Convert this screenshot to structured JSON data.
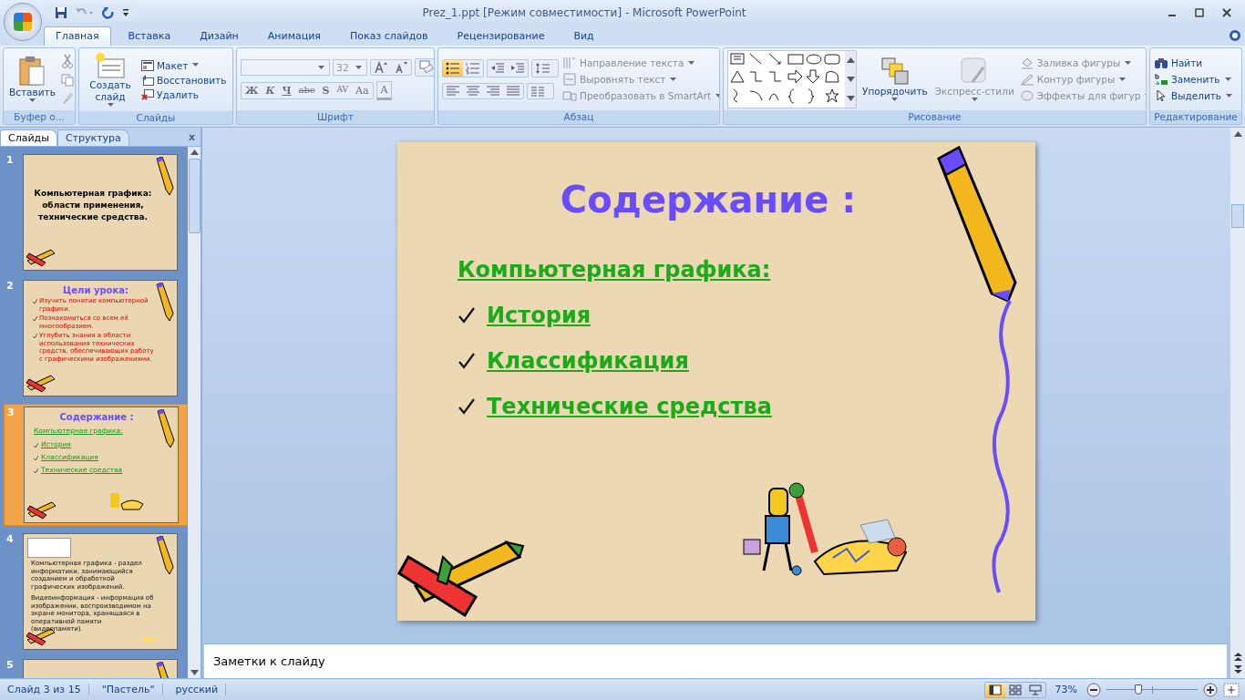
{
  "window": {
    "title": "Prez_1.ppt [Режим совместимости] - Microsoft PowerPoint"
  },
  "tabs": [
    {
      "label": "Главная",
      "selected": true
    },
    {
      "label": "Вставка",
      "selected": false
    },
    {
      "label": "Дизайн",
      "selected": false
    },
    {
      "label": "Анимация",
      "selected": false
    },
    {
      "label": "Показ слайдов",
      "selected": false
    },
    {
      "label": "Рецензирование",
      "selected": false
    },
    {
      "label": "Вид",
      "selected": false
    }
  ],
  "ribbon": {
    "clipboard": {
      "label": "Буфер о...",
      "paste": "Вставить"
    },
    "slides": {
      "label": "Слайды",
      "new_slide": "Создать слайд",
      "layout": "Макет",
      "reset": "Восстановить",
      "delete": "Удалить"
    },
    "font": {
      "label": "Шрифт",
      "disabled": true,
      "size": "32",
      "bold": "Ж",
      "italic": "К",
      "underline": "Ч",
      "strike": "abc",
      "shadow": "S",
      "spacing": "AV",
      "case": "Aa",
      "text_color_glyph": "A"
    },
    "paragraph": {
      "label": "Абзац",
      "bullets_on": true,
      "tools": [
        {
          "label": "Направление текста",
          "disabled": true
        },
        {
          "label": "Выровнять текст",
          "disabled": true
        },
        {
          "label": "Преобразовать в SmartArt",
          "disabled": true
        }
      ]
    },
    "drawing": {
      "label": "Рисование",
      "arrange": "Упорядочить",
      "quick_styles": {
        "label": "Экспресс-стили",
        "disabled": true
      },
      "tools": [
        {
          "label": "Заливка фигуры",
          "disabled": true
        },
        {
          "label": "Контур фигуры",
          "disabled": true
        },
        {
          "label": "Эффекты для фигур",
          "disabled": true
        }
      ]
    },
    "editing": {
      "label": "Редактирование",
      "find": "Найти",
      "replace": "Заменить",
      "select": "Выделить"
    }
  },
  "panel": {
    "tabs": [
      {
        "label": "Слайды",
        "selected": true
      },
      {
        "label": "Структура",
        "selected": false
      }
    ],
    "close": "x"
  },
  "slides": [
    {
      "number": "1",
      "selected": false,
      "kind": "title",
      "lines": [
        "Компьютерная графика:",
        "области применения,",
        "технические средства."
      ]
    },
    {
      "number": "2",
      "selected": false,
      "kind": "goals",
      "title": "Цели урока:",
      "lines": [
        "Изучить понятие компьютерной графики.",
        "Познакомиться со всем её многообразием.",
        "Углубить знания в области использования технических средств, обеспечивающих работу с графическими изображениями."
      ]
    },
    {
      "number": "3",
      "selected": true,
      "kind": "contents",
      "title": "Содержание :",
      "subtitle": "Компьютерная графика:",
      "lines": [
        "История",
        "Классификация",
        "Технические средства"
      ]
    },
    {
      "number": "4",
      "selected": false,
      "kind": "text",
      "lines": [
        "Компьютерная графика - раздел информатики, занимающийся созданием и обработкой графических изображений.",
        "Видеоинформация - информация об изображении, воспроизводимом на экране монитора, хранящаяся в оперативной памяти (видеопамяти)."
      ]
    },
    {
      "number": "5",
      "selected": false,
      "kind": "blank"
    }
  ],
  "slide": {
    "title": "Содержание :",
    "subtitle": "Компьютерная графика:",
    "bullets": [
      "История",
      "Классификация",
      "Технические средства"
    ]
  },
  "notes": {
    "placeholder": "Заметки к слайду"
  },
  "status_bar": {
    "slide": "Слайд 3 из 15",
    "theme": "\"Пастель\"",
    "language": "русский",
    "views": [
      {
        "selected": true
      },
      {
        "selected": false
      },
      {
        "selected": false
      }
    ],
    "zoom": "73%",
    "zoom_slider": {
      "level": 0.35
    }
  }
}
